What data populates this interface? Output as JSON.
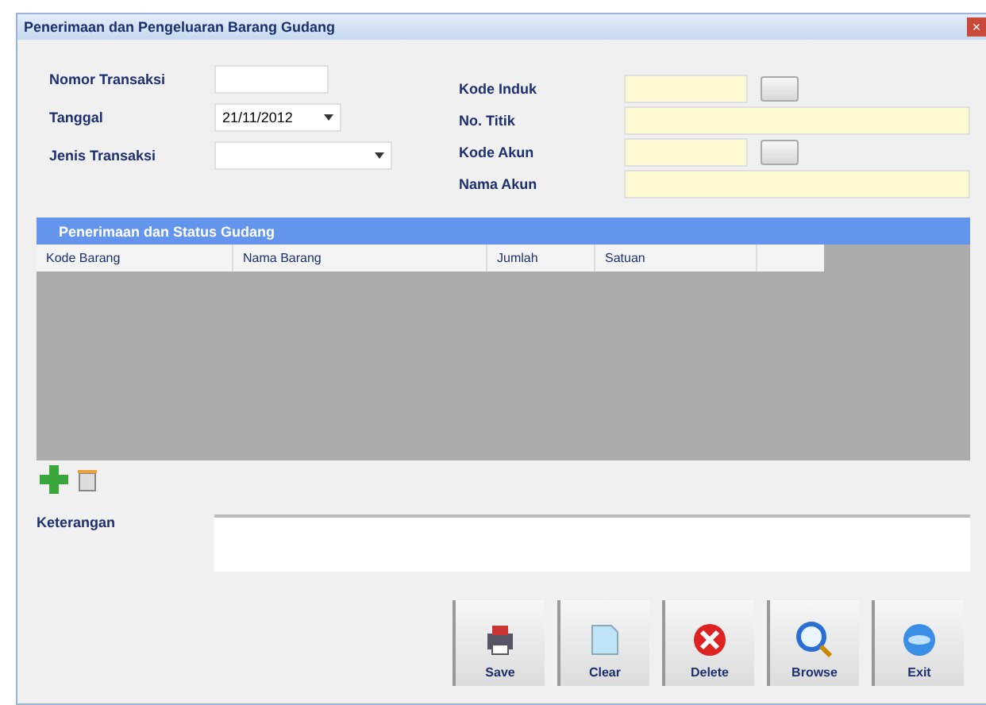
{
  "window": {
    "title": "Penerimaan dan Pengeluaran Barang Gudang",
    "close": "×"
  },
  "left_fields": [
    {
      "label": "Nomor Transaksi",
      "kind": "text"
    },
    {
      "label": "Tanggal",
      "kind": "date",
      "value": "21/11/2012"
    },
    {
      "label": "Jenis Transaksi",
      "kind": "combo"
    }
  ],
  "right_fields": [
    {
      "label": "Kode Induk",
      "kind": "lookup"
    },
    {
      "label": "No. Titik",
      "kind": "wide"
    },
    {
      "label": "Kode Akun",
      "kind": "lookup"
    },
    {
      "label": "Nama Akun",
      "kind": "wide"
    }
  ],
  "grid": {
    "title": "Penerimaan dan Status Gudang",
    "columns": [
      "Kode Barang",
      "Nama Barang",
      "Jumlah",
      "Satuan"
    ]
  },
  "note": {
    "label": "Keterangan"
  },
  "buttons": [
    {
      "label": "Save",
      "kind": "save"
    },
    {
      "label": "Clear",
      "kind": "clear"
    },
    {
      "label": "Delete",
      "kind": "delete"
    },
    {
      "label": "Browse",
      "kind": "browse"
    },
    {
      "label": "Exit",
      "kind": "exit"
    }
  ]
}
